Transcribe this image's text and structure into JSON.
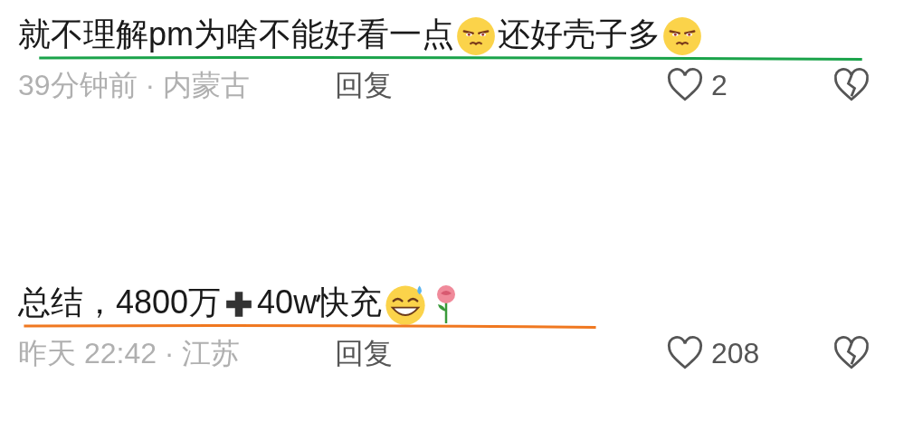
{
  "comments": [
    {
      "color": "#1aa34a",
      "body": [
        {
          "kind": "text",
          "text": "就不理解pm为啥不能好看一点"
        },
        {
          "kind": "smirk"
        },
        {
          "kind": "text",
          "text": "还好壳子多"
        },
        {
          "kind": "smirk"
        }
      ],
      "time": "39分钟前 · 内蒙古",
      "reply": "回复",
      "likes": "2"
    },
    {
      "color": "#f07820",
      "body": [
        {
          "kind": "text",
          "text": "总结，4800万"
        },
        {
          "kind": "plus"
        },
        {
          "kind": "text",
          "text": "40w快充"
        },
        {
          "kind": "sweat"
        },
        {
          "kind": "rose"
        }
      ],
      "time": "昨天 22:42 · 江苏",
      "reply": "回复",
      "likes": "208"
    }
  ]
}
